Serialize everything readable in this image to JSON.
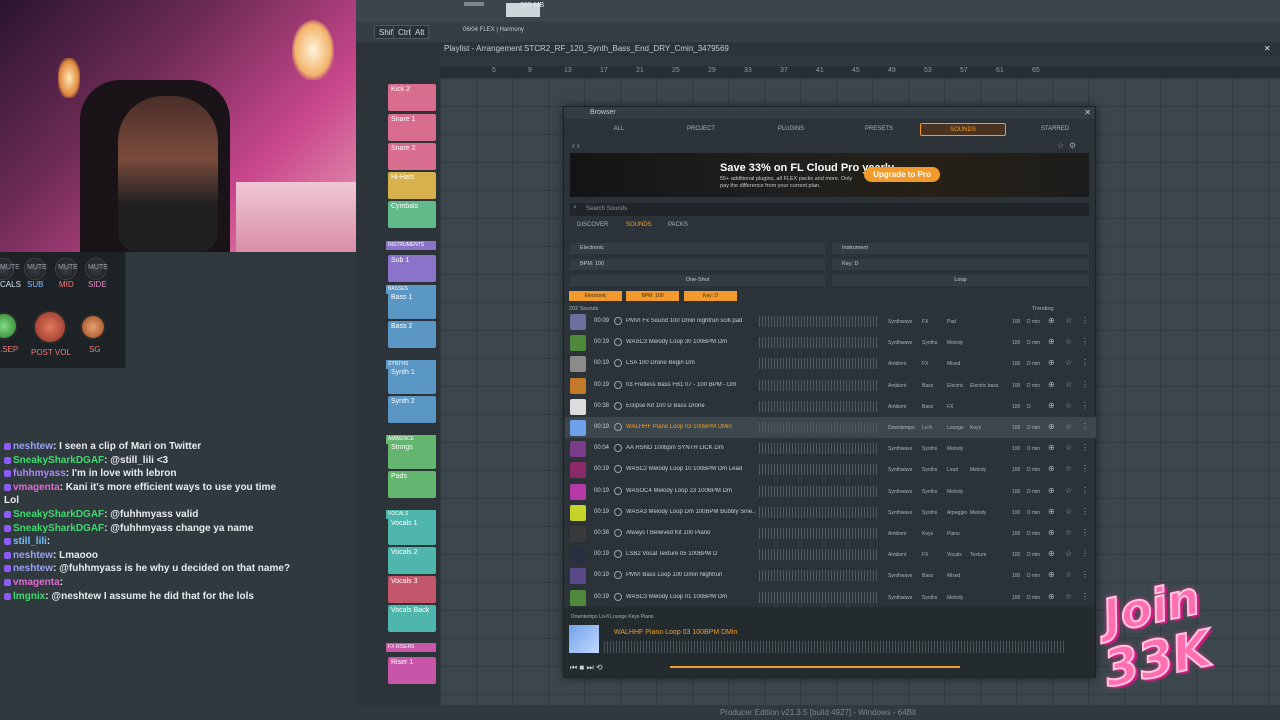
{
  "toolbar": {
    "mem": "385 MB",
    "cpu": "1",
    "keys": [
      "Shift",
      "Ctrl",
      "Alt"
    ],
    "pattern": "06/04 FLEX | Harmony"
  },
  "playlist": {
    "title": "Playlist - Arrangement",
    "clip": "STCR2_RF_120_Synth_Bass_End_DRY_Cmin_3479569"
  },
  "ruler": [
    "5",
    "9",
    "13",
    "17",
    "21",
    "25",
    "29",
    "33",
    "37",
    "41",
    "45",
    "49",
    "53",
    "57",
    "61",
    "65"
  ],
  "tracks": [
    {
      "label": "Kick 2",
      "color": "#d86d8f"
    },
    {
      "label": "Snare 1",
      "color": "#d86d8f"
    },
    {
      "label": "Snare 2",
      "color": "#d86d8f"
    },
    {
      "label": "Hi-Hats",
      "color": "#d7b14c"
    },
    {
      "label": "Cymbals",
      "color": "#62b98a"
    },
    {
      "label": "Sub 1",
      "color": "#8a73c9"
    },
    {
      "label": "Bass 1",
      "color": "#5a97c4"
    },
    {
      "label": "Bass 2",
      "color": "#5a97c4"
    },
    {
      "label": "Synth 1",
      "color": "#5a97c4"
    },
    {
      "label": "Synth 2",
      "color": "#5a97c4"
    },
    {
      "label": "Strings",
      "color": "#63b56f"
    },
    {
      "label": "Pads",
      "color": "#63b56f"
    },
    {
      "label": "Vocals 1",
      "color": "#4fb6ae"
    },
    {
      "label": "Vocals 2",
      "color": "#4fb6ae"
    },
    {
      "label": "Vocals 3",
      "color": "#c2576b"
    },
    {
      "label": "Vocals Back",
      "color": "#4fb6ae"
    },
    {
      "label": "Riser 1",
      "color": "#c856a8"
    }
  ],
  "groups": [
    "INSTRUMENTS",
    "BASSES",
    "SYNTHS",
    "AMBIENCE",
    "VOCALS",
    "FX RISERS"
  ],
  "mixer": {
    "labels": [
      "CALS",
      "SUB",
      "MID",
      "SIDE"
    ],
    "mute": "MUTE",
    "knobs": [
      ".SEP",
      "POST VOL",
      "SG"
    ]
  },
  "chat": [
    {
      "u": "neshtew",
      "c": "u1",
      "t": ": I seen a clip of Mari on Twitter"
    },
    {
      "u": "SneakySharkDGAF",
      "c": "u2",
      "t": ": @still_lili <3"
    },
    {
      "u": "fuhhmyass",
      "c": "u3",
      "t": ": I'm in love with lebron"
    },
    {
      "u": "vmagenta",
      "c": "u4",
      "t": ": Kani it's more efficient ways to use you time Lol"
    },
    {
      "u": "SneakySharkDGAF",
      "c": "u2",
      "t": ": @fuhhmyass valid"
    },
    {
      "u": "SneakySharkDGAF",
      "c": "u2",
      "t": ": @fuhhmyass change ya name"
    },
    {
      "u": "still_lili",
      "c": "u5",
      "t": ":"
    },
    {
      "u": "neshtew",
      "c": "u1",
      "t": ": Lmaooo"
    },
    {
      "u": "neshtew",
      "c": "u1",
      "t": ": @fuhhmyass is he why u decided on that name?"
    },
    {
      "u": "vmagenta",
      "c": "u4",
      "t": ":"
    },
    {
      "u": "lmgnix",
      "c": "u2",
      "t": ": @neshtew I assume he did that for the lols"
    }
  ],
  "browser": {
    "title": "Browser",
    "nav": [
      "ALL",
      "PROJECT",
      "PLUGINS",
      "PRESETS",
      "SOUNDS",
      "STARRED"
    ],
    "banner_h": "Save 33% on FL Cloud Pro yearly",
    "banner_s": "55+ additional plugins, all FLEX packs and more. Only pay the difference from your current plan.",
    "banner_btn": "Upgrade to Pro",
    "search": "Search Sounds",
    "subtabs": [
      "DISCOVER",
      "SOUNDS",
      "PACKS"
    ],
    "filters": [
      "Electronic",
      "Instrument",
      "BPM: 100",
      "Key: D"
    ],
    "modes": [
      "One-Shot",
      "Loop"
    ],
    "chips": [
      "Electronic",
      "BPM: 100",
      "Key: D"
    ],
    "count": "202 Sounds",
    "sort": "Trending",
    "rows": [
      {
        "d": "00:09",
        "n": "PMVI Fx Sound 100 Dmin nightrun scifi pad",
        "t": [
          "Synthwave",
          "FX",
          "Pad",
          ""
        ],
        "b": "100",
        "k": "D min",
        "c": "#6b6f9e"
      },
      {
        "d": "00:19",
        "n": "WASC3 Melody Loop 30 100BPM Dm",
        "t": [
          "Synthwave",
          "Synths",
          "Melody",
          ""
        ],
        "b": "100",
        "k": "D min",
        "c": "#4f8a3c"
      },
      {
        "d": "00:19",
        "n": "LSA 100 Drone Begin Dm",
        "t": [
          "Ambient",
          "FX",
          "Mixed",
          ""
        ],
        "b": "100",
        "k": "D min",
        "c": "#8b8b8b"
      },
      {
        "d": "00:19",
        "n": "03 Fretless Bass FB1 07 - 100 BPM - Dm",
        "t": [
          "Ambient",
          "Bass",
          "Electric",
          "Electric bass"
        ],
        "b": "100",
        "k": "D min",
        "c": "#c27a2a"
      },
      {
        "d": "00:38",
        "n": "Eclipse Kit 100 D Bass Drone",
        "t": [
          "Ambient",
          "Bass",
          "FX",
          ""
        ],
        "b": "100",
        "k": "D",
        "c": "#dcdcdc"
      },
      {
        "d": "00:19",
        "n": "WALHHF Piano Loop 03 100BPM DMin",
        "t": [
          "Downtempo",
          "Lo-fi",
          "Lounge",
          "Keys"
        ],
        "b": "100",
        "k": "D min",
        "c": "#6fa2e8",
        "sel": true
      },
      {
        "d": "00:04",
        "n": "AA RSND 100bpm SYNTH LICK Dm",
        "t": [
          "Synthwave",
          "Synths",
          "Melody",
          ""
        ],
        "b": "100",
        "k": "D min",
        "c": "#7a3c8a"
      },
      {
        "d": "00:19",
        "n": "WASC2 Melody Loop 10 100BPM Dm Lead",
        "t": [
          "Synthwave",
          "Synths",
          "Lead",
          "Melody"
        ],
        "b": "100",
        "k": "D min",
        "c": "#8a2a6a"
      },
      {
        "d": "00:19",
        "n": "WASOC4 Melody Loop 23 100BPM Dm",
        "t": [
          "Synthwave",
          "Synths",
          "Melody",
          ""
        ],
        "b": "100",
        "k": "D min",
        "c": "#b53aa8"
      },
      {
        "d": "00:19",
        "n": "WASA3 Melody Loop Dm 100BPM Bubbly Sine...",
        "t": [
          "Synthwave",
          "Synths",
          "Arpeggio",
          "Melody"
        ],
        "b": "100",
        "k": "D min",
        "c": "#c6d42a"
      },
      {
        "d": "00:38",
        "n": "Always I Believed Kit 100 Piano",
        "t": [
          "Ambient",
          "Keys",
          "Piano",
          ""
        ],
        "b": "100",
        "k": "D min",
        "c": "#3a3a3a"
      },
      {
        "d": "00:19",
        "n": "LSB2 Vocal Texture 05 100BPM D",
        "t": [
          "Ambient",
          "FX",
          "Vocals",
          "Texture"
        ],
        "b": "100",
        "k": "D min",
        "c": "#2a2f40"
      },
      {
        "d": "00:19",
        "n": "PMVI Bass Loop 100 Dmin Nightrun",
        "t": [
          "Synthwave",
          "Bass",
          "Mixed",
          ""
        ],
        "b": "100",
        "k": "D min",
        "c": "#5a4a8a"
      },
      {
        "d": "00:19",
        "n": "WASC3 Melody Loop 01 100BPM Dm",
        "t": [
          "Synthwave",
          "Synths",
          "Melody",
          ""
        ],
        "b": "100",
        "k": "D min",
        "c": "#4f8a3c"
      }
    ],
    "player": {
      "tags": "Downtempo   Lo-fi   Lounge   Keys   Piano",
      "title": "WALHHF Piano Loop 03 100BPM DMin"
    }
  },
  "footer": "Producer Edition v21.3.5 [build 4927] - Windows - 64Bit",
  "sticker": {
    "l1": "Join",
    "l2": "33K"
  }
}
